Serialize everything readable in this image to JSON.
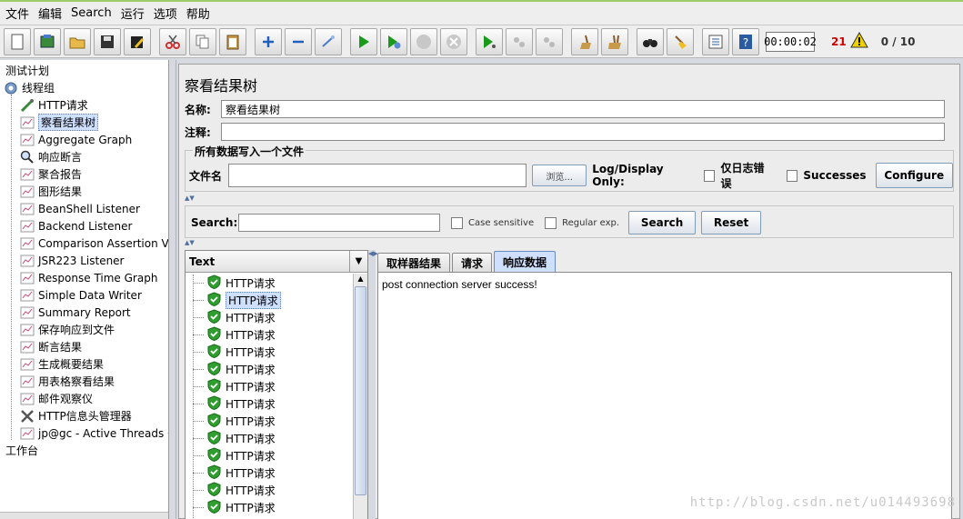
{
  "menu": [
    "文件",
    "编辑",
    "Search",
    "运行",
    "选项",
    "帮助"
  ],
  "toolbar": {
    "timer": "00:00:02",
    "error_count": "21",
    "thread_ratio": "0 / 10"
  },
  "tree": {
    "root": "测试计划",
    "group": "线程组",
    "children": [
      "HTTP请求",
      "察看结果树",
      "Aggregate Graph",
      "响应断言",
      "聚合报告",
      "图形结果",
      "BeanShell Listener",
      "Backend Listener",
      "Comparison Assertion V",
      "JSR223 Listener",
      "Response Time Graph",
      "Simple Data Writer",
      "Summary Report",
      "保存响应到文件",
      "断言结果",
      "生成概要结果",
      "用表格察看结果",
      "邮件观察仪",
      "HTTP信息头管理器",
      "jp@gc - Active Threads O"
    ],
    "workbench": "工作台"
  },
  "panel": {
    "title": "察看结果树",
    "name_label": "名称:",
    "name_value": "察看结果树",
    "comment_label": "注释:",
    "comment_value": "",
    "file_group_title": "所有数据写入一个文件",
    "filename_label": "文件名",
    "filename_value": "",
    "browse_label": "浏览...",
    "log_display_label": "Log/Display Only:",
    "errors_only_label": "仅日志错误",
    "successes_label": "Successes",
    "configure_label": "Configure"
  },
  "search": {
    "label": "Search:",
    "value": "",
    "case_sensitive_label": "Case sensitive",
    "regex_label": "Regular exp.",
    "search_button": "Search",
    "reset_button": "Reset"
  },
  "results": {
    "renderer": "Text",
    "items": [
      "HTTP请求",
      "HTTP请求",
      "HTTP请求",
      "HTTP请求",
      "HTTP请求",
      "HTTP请求",
      "HTTP请求",
      "HTTP请求",
      "HTTP请求",
      "HTTP请求",
      "HTTP请求",
      "HTTP请求",
      "HTTP请求",
      "HTTP请求"
    ],
    "tabs": [
      "取样器结果",
      "请求",
      "响应数据"
    ],
    "response_text": "post connection server success!"
  },
  "watermark": "http://blog.csdn.net/u014493698",
  "colors": {
    "selection": "#cfe0ff",
    "error": "#d00000",
    "success_shield": "#2e9e2e"
  }
}
